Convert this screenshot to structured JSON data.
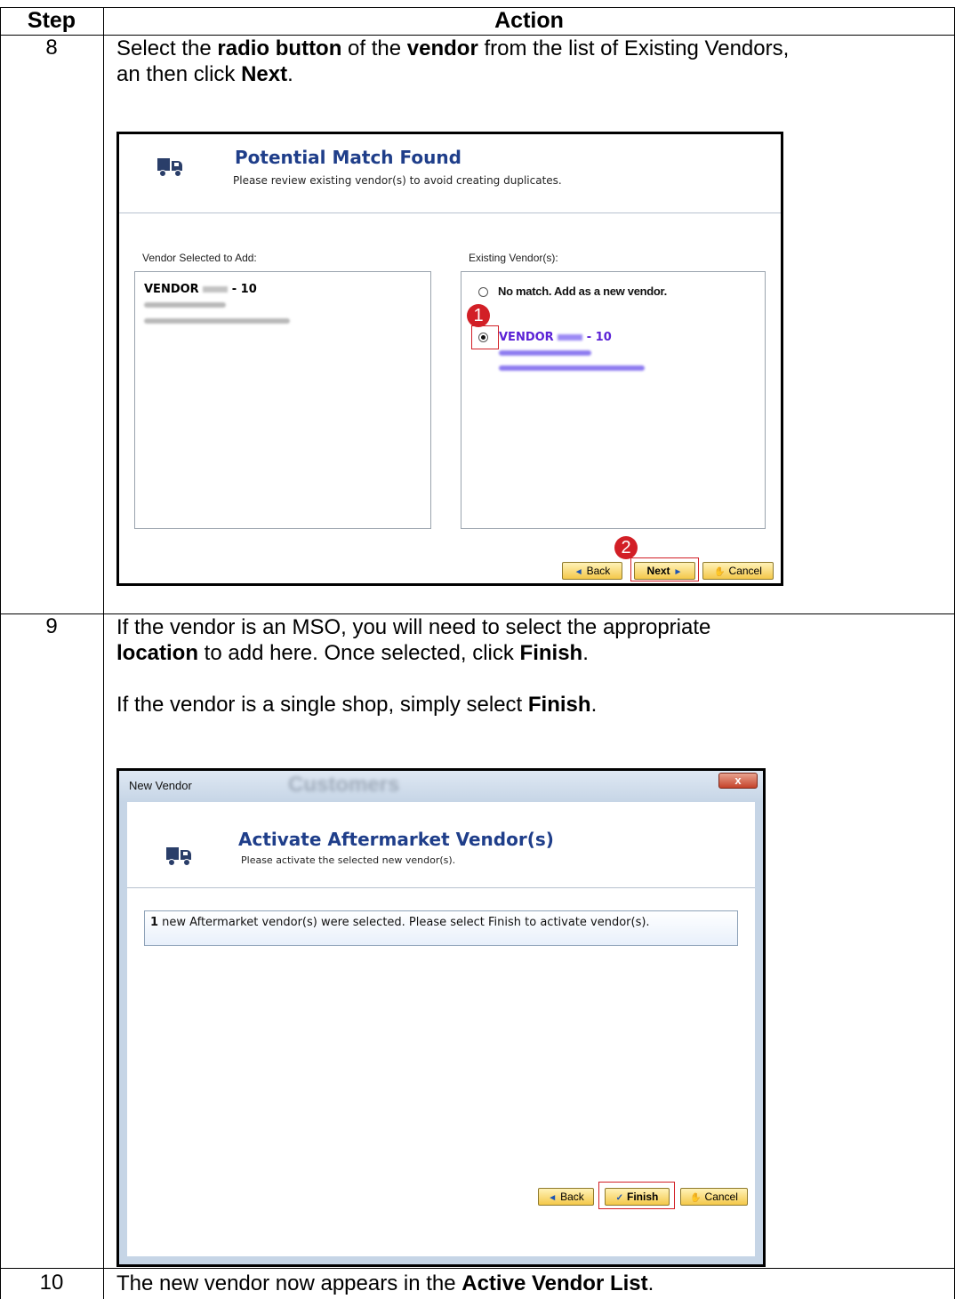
{
  "table": {
    "headers": {
      "step": "Step",
      "action": "Action"
    },
    "rows": [
      {
        "step": "8",
        "text": [
          {
            "t": "Select the "
          },
          {
            "t": "radio button",
            "b": true
          },
          {
            "t": " of the "
          },
          {
            "t": "vendor",
            "b": true
          },
          {
            "t": " from the list of Existing Vendors,"
          }
        ],
        "text2": [
          {
            "t": "an then click "
          },
          {
            "t": "Next",
            "b": true
          },
          {
            "t": "."
          }
        ]
      },
      {
        "step": "9",
        "line1": "If the vendor is an MSO, you will need to select the appropriate",
        "line2": [
          {
            "t": "location",
            "b": true
          },
          {
            "t": " to add here. Once selected, click "
          },
          {
            "t": "Finish",
            "b": true
          },
          {
            "t": "."
          }
        ],
        "line3": [
          {
            "t": "If the vendor is a single shop, simply select "
          },
          {
            "t": "Finish",
            "b": true
          },
          {
            "t": "."
          }
        ]
      },
      {
        "step": "10",
        "line1": [
          {
            "t": "The new vendor now appears in the "
          },
          {
            "t": "Active Vendor List",
            "b": true
          },
          {
            "t": "."
          }
        ]
      }
    ]
  },
  "screenshot1": {
    "title": "Potential Match Found",
    "subtitle": "Please review existing vendor(s) to avoid creating duplicates.",
    "left_label": "Vendor Selected to Add:",
    "right_label": "Existing Vendor(s):",
    "left_vendor_prefix": "VENDOR",
    "left_vendor_suffix": "- 10",
    "radio_no_match": "No match.  Add as a new vendor.",
    "right_vendor_prefix": "VENDOR",
    "right_vendor_suffix": "- 10",
    "callout1": "1",
    "callout2": "2",
    "buttons": {
      "back": "Back",
      "next": "Next",
      "cancel": "Cancel"
    },
    "selected_option": "existing-vendor"
  },
  "screenshot2": {
    "window_title": "New Vendor",
    "background_title": "Customers",
    "close_glyph": "x",
    "title": "Activate Aftermarket Vendor(s)",
    "subtitle": "Please activate the selected new vendor(s).",
    "info_count": "1",
    "info_text": " new Aftermarket vendor(s) were selected.  Please select Finish to activate vendor(s).",
    "buttons": {
      "back": "Back",
      "finish": "Finish",
      "cancel": "Cancel"
    }
  },
  "colors": {
    "title_blue": "#1f3e8a",
    "callout_red": "#d21f26",
    "vendor_purple": "#5b22d6",
    "button_gold": "#f4c84a"
  },
  "icons": [
    "truck-icon",
    "radio-unselected-icon",
    "radio-selected-icon",
    "arrow-left-icon",
    "arrow-right-icon",
    "hand-icon",
    "checkmark-icon",
    "close-icon"
  ]
}
